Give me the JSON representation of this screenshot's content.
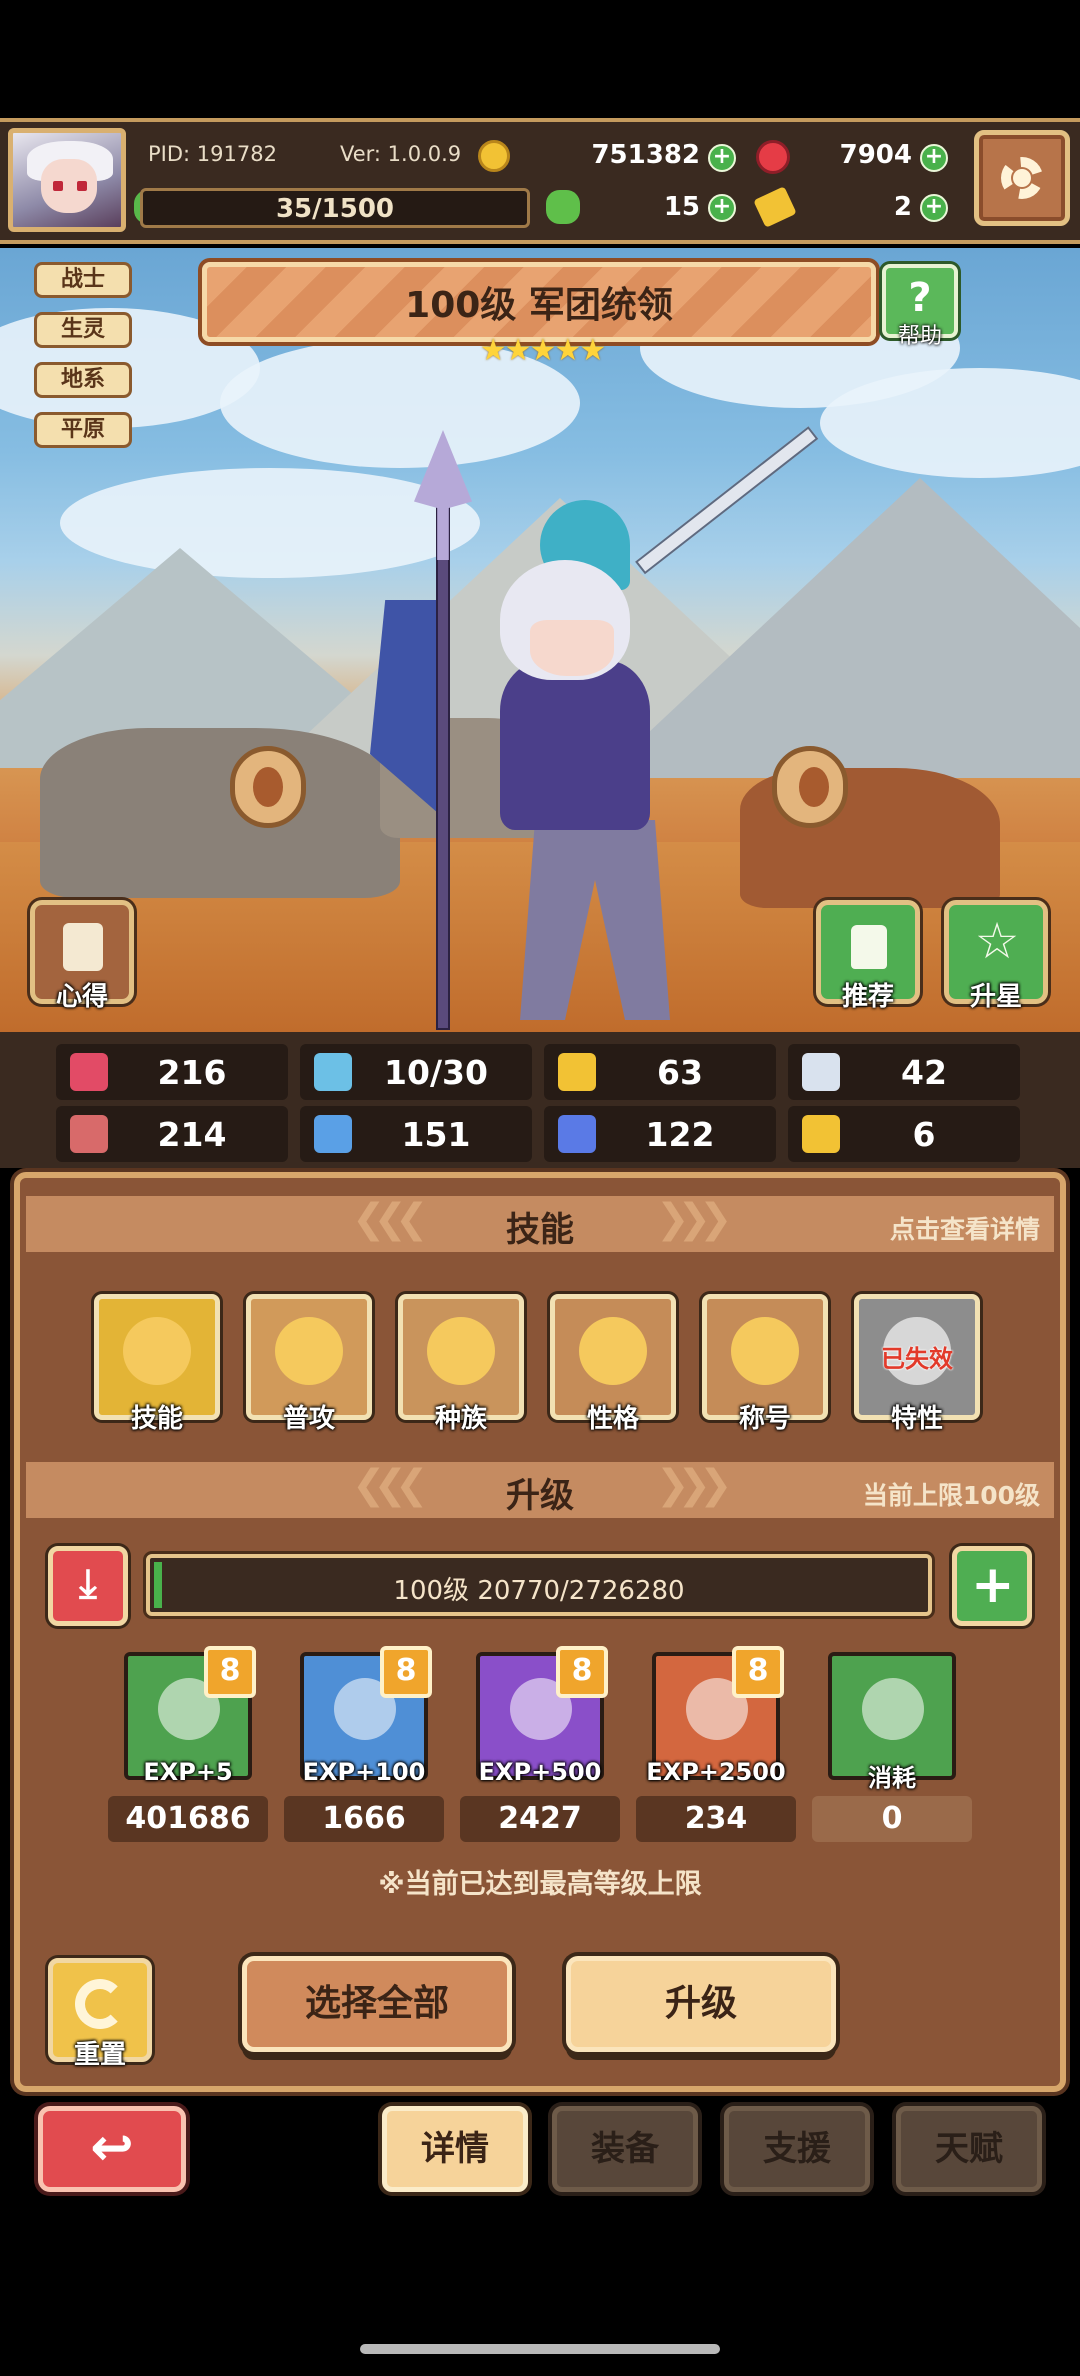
{
  "header": {
    "pid": "PID: 191782",
    "version": "Ver: 1.0.0.9",
    "gold": "751382",
    "gems": "7904",
    "stamina": "35/1500",
    "clover": "15",
    "tickets": "2"
  },
  "hero": {
    "tags": [
      "战士",
      "生灵",
      "地系",
      "平原"
    ],
    "title": "100级  军团统领",
    "stars": 5,
    "help_label": "帮助",
    "insight_label": "心得",
    "recommend_label": "推荐",
    "star_up_label": "升星"
  },
  "stats": [
    {
      "icon": "heart-icon",
      "value": "216"
    },
    {
      "icon": "water-drop-icon",
      "value": "10/30"
    },
    {
      "icon": "shield-icon",
      "value": "63"
    },
    {
      "icon": "wing-icon",
      "value": "42"
    },
    {
      "icon": "fist-icon",
      "value": "214"
    },
    {
      "icon": "book-icon",
      "value": "151"
    },
    {
      "icon": "flag-icon",
      "value": "122"
    },
    {
      "icon": "horseshoe-icon",
      "value": "6"
    }
  ],
  "skills_section": {
    "title": "技能",
    "hint": "点击查看详情",
    "items": [
      {
        "label": "技能",
        "color": "#e3b436"
      },
      {
        "label": "普攻",
        "color": "#d19a5a"
      },
      {
        "label": "种族",
        "color": "#c9945c"
      },
      {
        "label": "性格",
        "color": "#c58c58"
      },
      {
        "label": "称号",
        "color": "#c58c58"
      },
      {
        "label": "特性",
        "color": "#8d8d8d",
        "overlay": "已失效"
      }
    ]
  },
  "upgrade_section": {
    "title": "升级",
    "hint": "当前上限100级",
    "exp_text": "100级  20770/2726280",
    "exp_progress": 0.0076,
    "items": [
      {
        "label": "EXP+5",
        "count": "401686",
        "color": "#4ea24f",
        "badge": "8"
      },
      {
        "label": "EXP+100",
        "count": "1666",
        "color": "#4f8fd6",
        "badge": "8"
      },
      {
        "label": "EXP+500",
        "count": "2427",
        "color": "#8a4fc9",
        "badge": "8"
      },
      {
        "label": "EXP+2500",
        "count": "234",
        "color": "#d3673f",
        "badge": "8"
      },
      {
        "label": "消耗",
        "count": "0",
        "color": "#4ea24f",
        "badge": ""
      }
    ],
    "notice": "※当前已达到最高等级上限",
    "reset_label": "重置",
    "select_all_label": "选择全部",
    "upgrade_label": "升级"
  },
  "tabs": [
    {
      "label": "详情",
      "active": true
    },
    {
      "label": "装备",
      "active": false
    },
    {
      "label": "支援",
      "active": false
    },
    {
      "label": "天赋",
      "active": false
    }
  ]
}
